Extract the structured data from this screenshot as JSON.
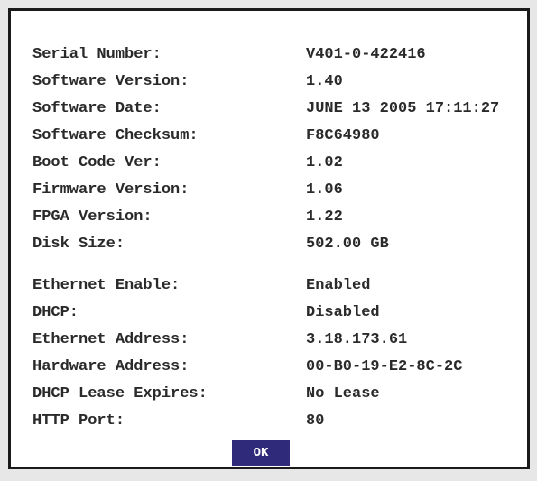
{
  "info": {
    "rows": [
      {
        "label": "Serial Number:",
        "value": "V401-0-422416"
      },
      {
        "label": "Software Version:",
        "value": "1.40"
      },
      {
        "label": "Software Date:",
        "value": "JUNE 13 2005 17:11:27"
      },
      {
        "label": "Software Checksum:",
        "value": "F8C64980"
      },
      {
        "label": "Boot Code Ver:",
        "value": "1.02"
      },
      {
        "label": "Firmware Version:",
        "value": "1.06"
      },
      {
        "label": "FPGA Version:",
        "value": "1.22"
      },
      {
        "label": "Disk Size:",
        "value": "502.00 GB"
      },
      {
        "label": "Ethernet Enable:",
        "value": "Enabled"
      },
      {
        "label": "DHCP:",
        "value": "Disabled"
      },
      {
        "label": "Ethernet Address:",
        "value": "3.18.173.61"
      },
      {
        "label": "Hardware Address:",
        "value": "00-B0-19-E2-8C-2C"
      },
      {
        "label": "DHCP Lease Expires:",
        "value": "No Lease"
      },
      {
        "label": "HTTP Port:",
        "value": "80"
      }
    ]
  },
  "ok_label": "OK",
  "colors": {
    "ok_background": "#2f2a7a",
    "ok_text": "#ffffff",
    "text": "#2a2a2a",
    "border": "#1a1a1a"
  }
}
